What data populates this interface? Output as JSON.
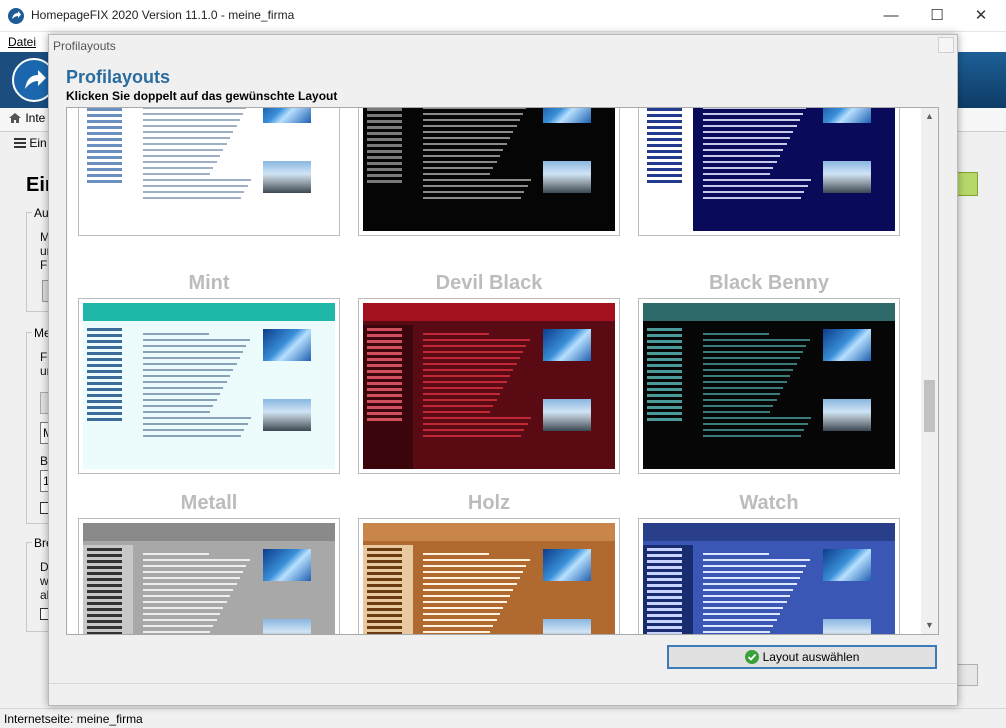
{
  "window": {
    "title": "HomepageFIX 2020 Version 11.1.0 - meine_firma",
    "minimize_glyph": "—",
    "maximize_glyph": "☐",
    "close_glyph": "✕"
  },
  "menu": {
    "file": "Datei"
  },
  "background": {
    "home_tab": "Inte",
    "sub_tab": "Ein",
    "heading": "Ein",
    "group1": "Aut",
    "group1_lines": [
      "M",
      "ur",
      "Fa"
    ],
    "group2": "Mer",
    "group2_lines": [
      "Fe",
      "ur"
    ],
    "group2_field": "M",
    "group2_label": "Br",
    "group2_field2": "1",
    "group3": "Bre",
    "group3_lines": [
      "D",
      "w",
      "al"
    ]
  },
  "status_bar": {
    "text": "Internetseite: meine_firma"
  },
  "dialog": {
    "window_title": "Profilayouts",
    "heading": "Profilayouts",
    "subheading": "Klicken Sie doppelt auf das gewünschte Layout",
    "select_button": "Layout auswählen",
    "layouts": [
      {
        "name": "",
        "palette": {
          "bg": "#ffffff",
          "head": "#ffffff",
          "nav": "#ffffff",
          "navtext": "#6a8fc0",
          "text": "#9fb0c6"
        }
      },
      {
        "name": "",
        "palette": {
          "bg": "#050505",
          "head": "#050505",
          "nav": "#050505",
          "navtext": "#7a7a7a",
          "text": "#8a8a8a"
        }
      },
      {
        "name": "",
        "palette": {
          "bg": "#0a0a5a",
          "head": "#ffffff",
          "nav": "#ffffff",
          "navtext": "#233b8e",
          "text": "#c8c8e8"
        }
      },
      {
        "name": "Mint",
        "palette": {
          "bg": "#ecfbfb",
          "head": "#1fb8a8",
          "nav": "#ecfbfb",
          "navtext": "#3c6d9a",
          "text": "#8aa3ba"
        }
      },
      {
        "name": "Devil Black",
        "palette": {
          "bg": "#5a0a12",
          "head": "#a5121f",
          "nav": "#3a050b",
          "navtext": "#d05060",
          "text": "#c02838"
        }
      },
      {
        "name": "Black Benny",
        "palette": {
          "bg": "#060606",
          "head": "#2e6a6a",
          "nav": "#060606",
          "navtext": "#4a9a9a",
          "text": "#3a7a7a"
        }
      },
      {
        "name": "Metall",
        "palette": {
          "bg": "#a8a8a8",
          "head": "#8a8a8a",
          "nav": "#c8c8c8",
          "navtext": "#333333",
          "text": "#eeeeee"
        }
      },
      {
        "name": "Holz",
        "palette": {
          "bg": "#b06a30",
          "head": "#c8864a",
          "nav": "#e9c9a0",
          "navtext": "#6a3a10",
          "text": "#fff2de"
        }
      },
      {
        "name": "Watch",
        "palette": {
          "bg": "#3b57b5",
          "head": "#2a3f8a",
          "nav": "#1a2c70",
          "navtext": "#c8d4ff",
          "text": "#dfe6ff"
        }
      }
    ]
  }
}
